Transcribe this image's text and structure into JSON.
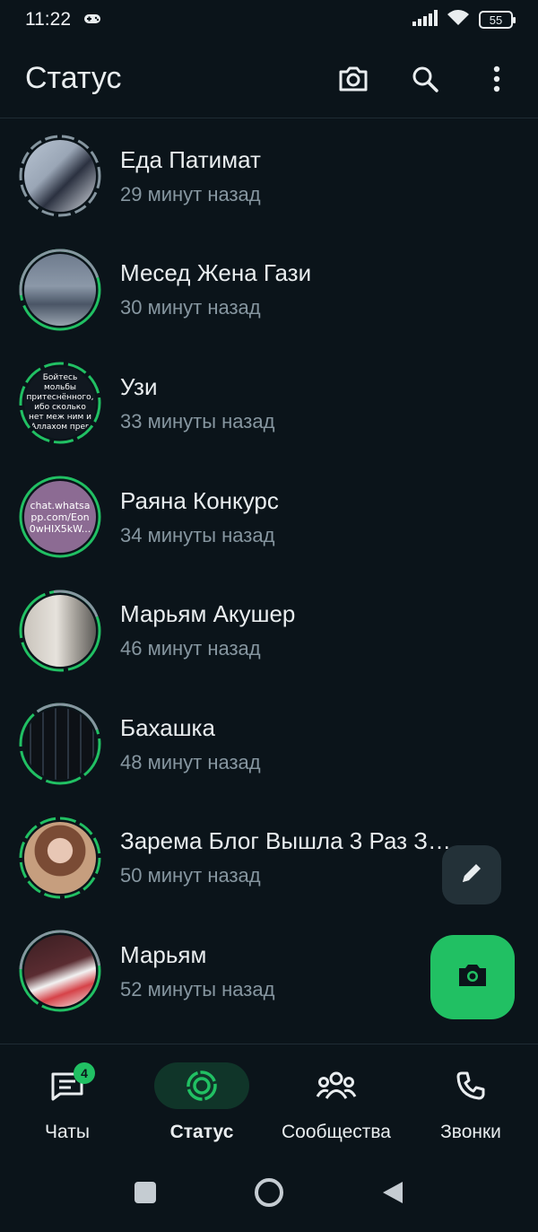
{
  "status_bar": {
    "time": "11:22",
    "battery": "55",
    "icons": [
      "gamepad-icon",
      "signal-icon",
      "wifi-icon",
      "battery-icon"
    ]
  },
  "header": {
    "title": "Статус",
    "actions": [
      "camera-icon",
      "search-icon",
      "more-vert-icon"
    ]
  },
  "statuses": [
    {
      "name": "Еда Патимат",
      "time": "29 минут назад",
      "ring": "seen"
    },
    {
      "name": "Месед Жена Гази",
      "time": "30 минут назад",
      "ring": "partial"
    },
    {
      "name": "Узи",
      "time": "33 минуты назад",
      "ring": "new",
      "avatar_text": "Бойтесь мольбы притеснённого, ибо сколько нет меж ним и Аллахом прег"
    },
    {
      "name": "Раяна Конкурс",
      "time": "34 минуты назад",
      "ring": "new",
      "avatar_text": "chat.whatsapp.com/Eon0wHIX5kW..."
    },
    {
      "name": "Марьям Акушер",
      "time": "46 минут назад",
      "ring": "partial"
    },
    {
      "name": "Бахашка",
      "time": "48 минут назад",
      "ring": "partial"
    },
    {
      "name": "Зарема Блог Вышла 3 Раз З…",
      "time": "50 минут назад",
      "ring": "new"
    },
    {
      "name": "Марьям",
      "time": "52 минуты назад",
      "ring": "partial"
    }
  ],
  "fabs": {
    "pencil": "pencil-icon",
    "camera": "camera-icon"
  },
  "nav": [
    {
      "label": "Чаты",
      "icon": "chats-icon",
      "badge": "4",
      "active": false
    },
    {
      "label": "Статус",
      "icon": "status-icon",
      "active": true
    },
    {
      "label": "Сообщества",
      "icon": "communities-icon",
      "active": false
    },
    {
      "label": "Звонки",
      "icon": "calls-icon",
      "active": false
    }
  ],
  "colors": {
    "background": "#0b141a",
    "accent": "#21c063",
    "seen_ring": "#8696a0",
    "text_secondary": "#8696a0"
  }
}
